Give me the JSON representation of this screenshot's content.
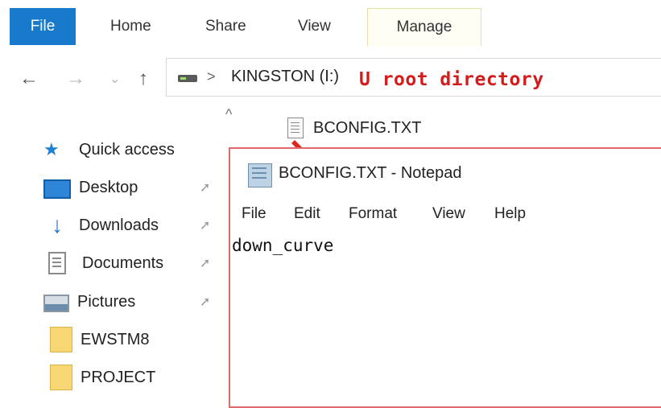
{
  "ribbon": {
    "tabs": [
      "File",
      "Home",
      "Share",
      "View",
      "Manage"
    ]
  },
  "address": {
    "back_glyph": "←",
    "forward_glyph": "→",
    "recent_glyph": "⌄",
    "up_glyph": "↑",
    "separator": ">",
    "path": "KINGSTON (I:)"
  },
  "annotation": {
    "text": "U root directory",
    "color": "#d41b1b"
  },
  "nav_pane": {
    "scroll_up_glyph": "^",
    "quick_access": "Quick access",
    "items": [
      {
        "label": "Desktop",
        "icon": "desktop-icon",
        "pinned": true
      },
      {
        "label": "Downloads",
        "icon": "download-icon",
        "pinned": true
      },
      {
        "label": "Documents",
        "icon": "documents-icon",
        "pinned": true
      },
      {
        "label": "Pictures",
        "icon": "pictures-icon",
        "pinned": true
      },
      {
        "label": "EWSTM8",
        "icon": "folder-icon",
        "pinned": false
      },
      {
        "label": "PROJECT",
        "icon": "folder-icon",
        "pinned": false
      }
    ],
    "pin_glyph": "📌"
  },
  "files": [
    {
      "name": "BCONFIG.TXT",
      "icon": "text-file-icon"
    }
  ],
  "notepad": {
    "title": "BCONFIG.TXT - Notepad",
    "menu": [
      "File",
      "Edit",
      "Format",
      "View",
      "Help"
    ],
    "content": "down_curve"
  },
  "colors": {
    "file_tab": "#1979ca",
    "annotation": "#d41b1b",
    "notepad_border": "#e06a6a"
  }
}
